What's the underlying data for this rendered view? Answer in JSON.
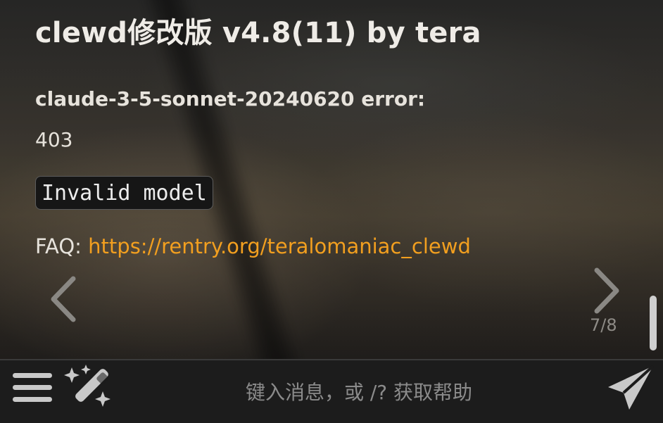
{
  "message": {
    "title": "clewd修改版 v4.8(11) by tera",
    "error_label": "claude-3-5-sonnet-20240620 error:",
    "status_code": "403",
    "error_detail": "Invalid model",
    "faq_prefix": "FAQ: ",
    "faq_link": "https://rentry.org/teralomaniac_clewd"
  },
  "swipe": {
    "counter": "7/8",
    "prev_icon": "chevron-left-icon",
    "next_icon": "chevron-right-icon"
  },
  "input_bar": {
    "placeholder": "键入消息，或 /? 获取帮助",
    "menu_icon": "hamburger-menu-icon",
    "wand_icon": "magic-wand-icon",
    "send_icon": "send-paper-plane-icon"
  },
  "colors": {
    "link": "#f29f1f",
    "bar_background": "#1c1c1c",
    "text": "#e9e6e1"
  }
}
